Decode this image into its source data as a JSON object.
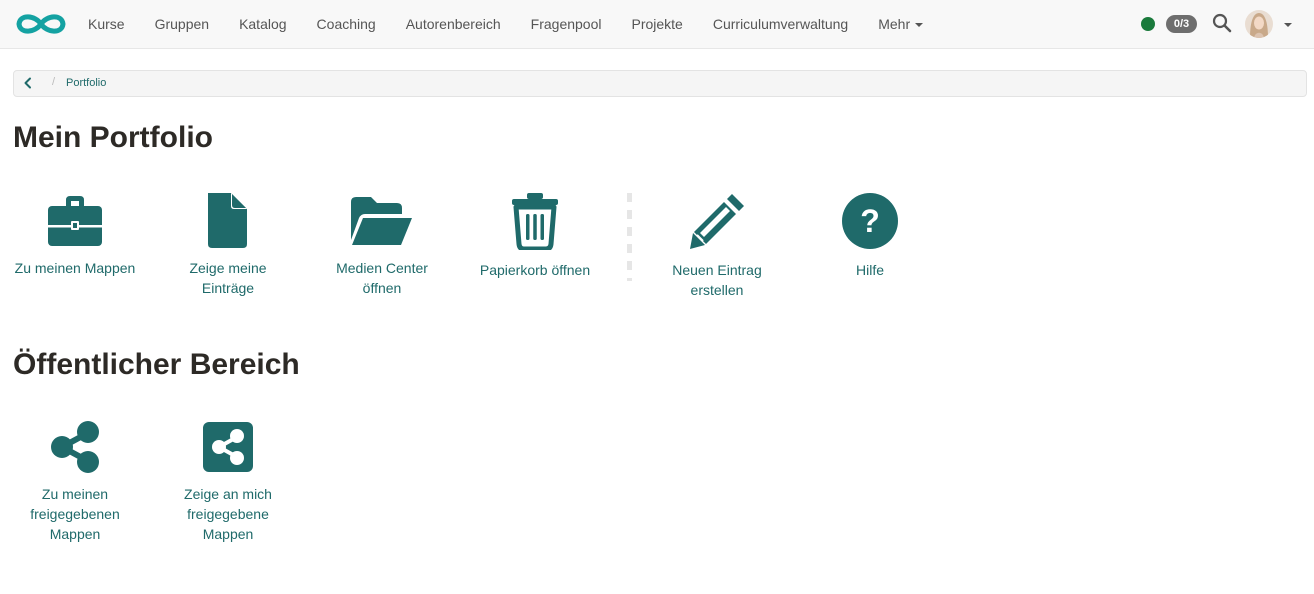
{
  "nav": {
    "items": [
      {
        "label": "Kurse"
      },
      {
        "label": "Gruppen"
      },
      {
        "label": "Katalog"
      },
      {
        "label": "Coaching"
      },
      {
        "label": "Autorenbereich"
      },
      {
        "label": "Fragenpool"
      },
      {
        "label": "Projekte"
      },
      {
        "label": "Curriculumverwaltung"
      },
      {
        "label": "Mehr"
      }
    ],
    "counter": "0/3",
    "status_color": "#1a7a3c"
  },
  "breadcrumb": {
    "current": "Portfolio",
    "separator": "/"
  },
  "portfolio": {
    "title": "Mein Portfolio",
    "tiles": [
      {
        "label": "Zu meinen Mappen",
        "icon": "briefcase-icon"
      },
      {
        "label": "Zeige meine Einträge",
        "icon": "file-icon"
      },
      {
        "label": "Medien Center öffnen",
        "icon": "folder-open-icon"
      },
      {
        "label": "Papierkorb öffnen",
        "icon": "trash-icon"
      },
      {
        "label": "Neuen Eintrag erstellen",
        "icon": "pencil-icon"
      },
      {
        "label": "Hilfe",
        "icon": "question-circle-icon"
      }
    ]
  },
  "public": {
    "title": "Öffentlicher Bereich",
    "tiles": [
      {
        "label": "Zu meinen freigegebenen Mappen",
        "icon": "share-icon"
      },
      {
        "label": "Zeige an mich freigegebene Mappen",
        "icon": "share-square-icon"
      }
    ]
  },
  "colors": {
    "accent": "#1f6a6a",
    "heading": "#2d2a26"
  }
}
